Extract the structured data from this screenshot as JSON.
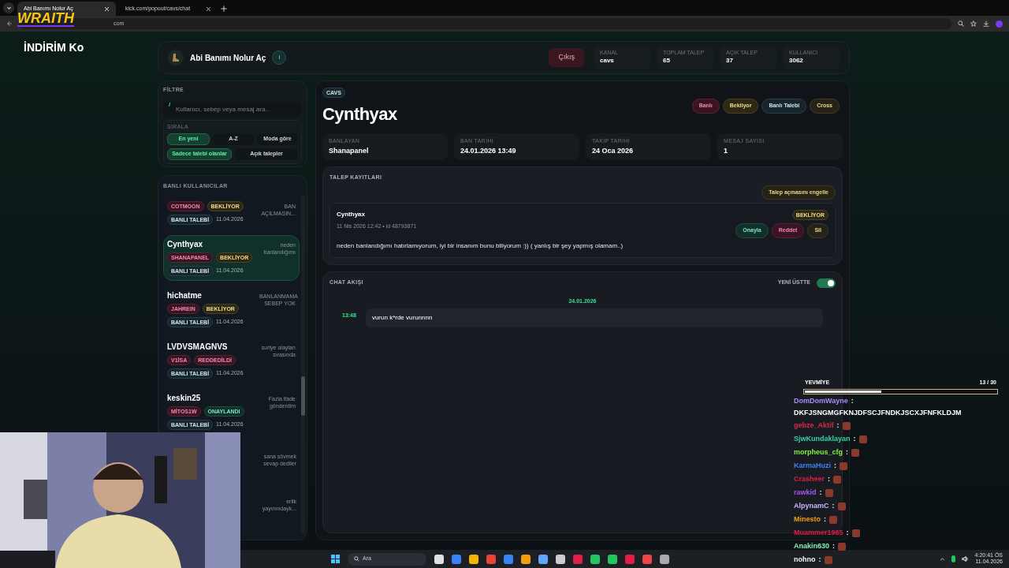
{
  "browser": {
    "tabs": [
      {
        "title": "Abi Banımı Nolur Aç",
        "selected": true
      },
      {
        "title": "kick.com/popout/cavs/chat",
        "selected": false
      }
    ],
    "address": "com"
  },
  "overlay": {
    "logo": "WRAITH",
    "promo": "İNDİRİM Ko"
  },
  "header": {
    "title": "Abi Banımı Nolur Aç",
    "info": "i",
    "logout": "Çıkış",
    "stats": [
      {
        "label": "KANAL",
        "value": "cavs"
      },
      {
        "label": "TOPLAM TALEP",
        "value": "65"
      },
      {
        "label": "AÇIK TALEP",
        "value": "37"
      },
      {
        "label": "KULLANICI",
        "value": "3062"
      }
    ]
  },
  "filter": {
    "title": "FİLTRE",
    "prompt": "/",
    "placeholder": "Kullanıcı, sebep veya mesaj ara...",
    "sort_label": "SIRALA",
    "sort_options": [
      {
        "label": "En yeni",
        "selected": true
      },
      {
        "label": "A-Z",
        "selected": false
      },
      {
        "label": "Moda göre",
        "selected": false
      }
    ],
    "filter_options": [
      {
        "label": "Sadece talebi olanlar",
        "selected": true
      },
      {
        "label": "Açık talepler",
        "selected": false
      }
    ]
  },
  "users": {
    "title": "BANLI KULLANICILAR",
    "items": [
      {
        "kind": "full",
        "mod": "COTMOON",
        "status": {
          "label": "BEKLİYOR",
          "kind": "pending"
        },
        "tag": "BANLI TALEBİ",
        "date": "11.04.2026",
        "reason": "BAN AÇILMASIN...",
        "selected": false
      },
      {
        "kind": "full",
        "name": "Cynthyax",
        "mod": "SHANAPANEL",
        "status": {
          "label": "BEKLİYOR",
          "kind": "pending"
        },
        "tag": "BANLI TALEBİ",
        "date": "11.04.2026",
        "reason": "neden banlandığımı",
        "selected": true
      },
      {
        "kind": "full",
        "name": "hichatme",
        "mod": "JAHREIN",
        "status": {
          "label": "BEKLİYOR",
          "kind": "pending"
        },
        "tag": "BANLI TALEBİ",
        "date": "11.04.2026",
        "reason": "BANLANMAMA SEBEP YOK",
        "selected": false
      },
      {
        "kind": "full",
        "name": "LVDVSMAGNVS",
        "mod": "V1İSA",
        "status": {
          "label": "REDDEDİLDİ",
          "kind": "rejected"
        },
        "tag": "BANLI TALEBİ",
        "date": "11.04.2026",
        "reason": "suriye olayları sırasında",
        "selected": false
      },
      {
        "kind": "full",
        "name": "keskin25",
        "mod": "MİTOS1W",
        "status": {
          "label": "ONAYLANDI",
          "kind": "approved"
        },
        "tag": "BANLI TALEBİ",
        "date": "11.04.2026",
        "reason": "Fazla ifade gönderdim",
        "selected": false
      },
      {
        "kind": "partial",
        "reason": "sana sövmek sevap dediler"
      },
      {
        "kind": "partial",
        "reason": "erlik yayınındayk..."
      }
    ]
  },
  "detail": {
    "channel": "CAVS",
    "name": "Cynthyax",
    "tags": [
      {
        "label": "Banlı",
        "kind": "banned"
      },
      {
        "label": "Bekliyor",
        "kind": "pending"
      },
      {
        "label": "Banlı Talebi",
        "kind": "request"
      },
      {
        "label": "Cross",
        "kind": "cross"
      }
    ],
    "fields": [
      {
        "label": "BANLAYAN",
        "value": "Shanapanel"
      },
      {
        "label": "BAN TARİHİ",
        "value": "24.01.2026 13:49"
      },
      {
        "label": "TAKİP TARİHİ",
        "value": "24 Oca 2026"
      },
      {
        "label": "MESAJ SAYISI",
        "value": "1"
      }
    ],
    "requests": {
      "title": "TALEP KAYITLARI",
      "block_button": "Talep açmasını engelle",
      "entries": [
        {
          "user": "Cynthyax",
          "meta": "11 Nis 2026 12:42 • id 48793871",
          "status": {
            "label": "BEKLİYOR",
            "kind": "pending"
          },
          "actions": [
            {
              "label": "Onayla",
              "kind": "approved"
            },
            {
              "label": "Reddet",
              "kind": "rejected"
            },
            {
              "label": "Sil",
              "kind": "cross"
            }
          ],
          "message": "neden banlandığımı hatırlamıyorum, iyi bir insanım bunu biliyorum :)) ( yanlış bir şey yapmış olamam..)"
        }
      ]
    },
    "chat": {
      "title": "CHAT AKIŞI",
      "toggle_label": "YENİ ÜSTTE",
      "toggle_on": true,
      "date": "24.01.2026",
      "messages": [
        {
          "time": "13:48",
          "text": "vurun k*rde vurunnnn"
        }
      ]
    }
  },
  "stream_chat": {
    "separator": ":",
    "goal_label": "YEVMİYE",
    "goal_count": "13 / 30",
    "level": 0.4,
    "messages": [
      {
        "user": "DomDomWayne",
        "color": "#a78bfa",
        "text": "DKFJSNGMGFKNJDFSCJFNDKJSCXJFNFKLDJM"
      },
      {
        "user": "gebze_Aktif",
        "color": "#dc2640"
      },
      {
        "user": "SjwKundaklayan",
        "color": "#34d3a0"
      },
      {
        "user": "morpheus_cfg",
        "color": "#7ef03a"
      },
      {
        "user": "KarmaHuzi",
        "color": "#3b82f6"
      },
      {
        "user": "Crasheer",
        "color": "#e11d48"
      },
      {
        "user": "rawkid",
        "color": "#a855f7"
      },
      {
        "user": "AlpynamC",
        "color": "#c4b5fd"
      },
      {
        "user": "Minesto",
        "color": "#f59e0b"
      },
      {
        "user": "Muammer1965",
        "color": "#e11d48"
      },
      {
        "user": "Anakin630",
        "color": "#86efac"
      },
      {
        "user": "nohno",
        "color": "#f5f5f5"
      }
    ]
  },
  "taskbar": {
    "search": "Ara",
    "time": "4:20:41 ÖS",
    "date": "11.04.2026"
  }
}
